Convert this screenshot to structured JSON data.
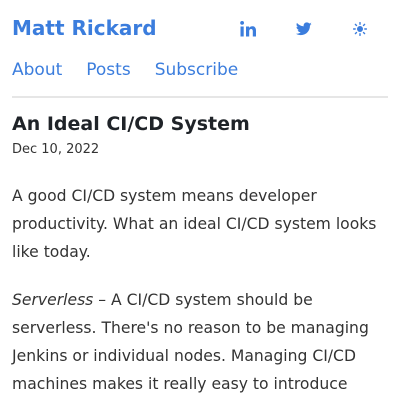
{
  "header": {
    "site_title": "Matt Rickard",
    "social_icons": [
      "linkedin-icon",
      "twitter-icon",
      "sun-icon"
    ]
  },
  "nav": {
    "items": [
      "About",
      "Posts",
      "Subscribe"
    ]
  },
  "post": {
    "title": "An Ideal CI/CD System",
    "date": "Dec 10, 2022",
    "paragraph1": "A good CI/CD system means developer productivity. What an ideal CI/CD system looks like today.",
    "paragraph2_emphasis": "Serverless",
    "paragraph2_rest": " – A CI/CD system should be serverless. There's no reason to be managing Jenkins or individual nodes. Managing CI/CD machines makes it really easy to introduce"
  },
  "colors": {
    "accent": "#3b7ddd",
    "text": "#333333",
    "title": "#1f2328",
    "divider": "#e6e6e6"
  }
}
